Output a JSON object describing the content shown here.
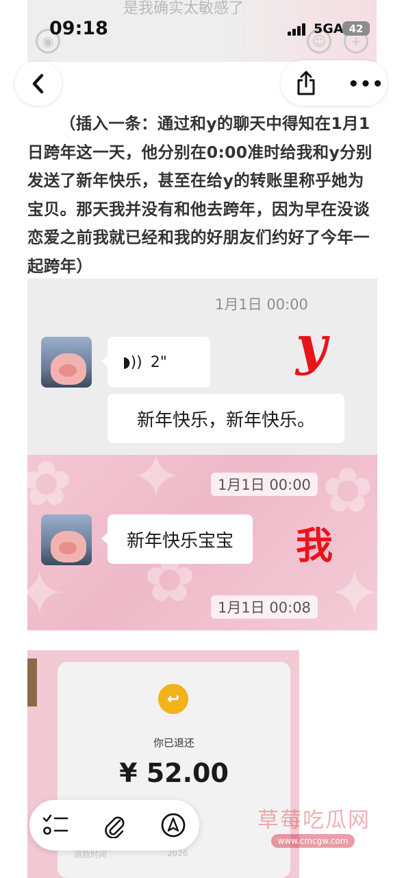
{
  "status_bar": {
    "time": "09:18",
    "network": "5GA",
    "battery": "42"
  },
  "background_strip": {
    "text": "是我确实太敏感了"
  },
  "nav": {
    "back_icon": "chevron-left-icon",
    "share_icon": "share-icon",
    "more_icon": "more-icon"
  },
  "article": {
    "paragraph": "（插入一条：通过和y的聊天中得知在1月1日跨年这一天，他分别在0:00准时给我和y分别发送了新年快乐，甚至在给y的转账里称乎她为宝贝。那天我并没有和他去跨年，因为早在没谈恋爱之前我就已经和我的好朋友们约好了今年一起跨年）"
  },
  "chat_y": {
    "timestamp": "1月1日 00:00",
    "voice_duration": "2\"",
    "message": "新年快乐，新年快乐。",
    "annotation": "y"
  },
  "chat_me": {
    "timestamp_top": "1月1日 00:00",
    "message": "新年快乐宝宝",
    "annotation": "我",
    "timestamp_bottom": "1月1日 00:08"
  },
  "transfer": {
    "status_label": "你已退还",
    "amount": "¥ 52.00",
    "row_label": "退款时间",
    "year_fragment": "2026"
  },
  "toolbar": {
    "items": [
      "list-icon",
      "paperclip-icon",
      "navigate-icon"
    ]
  },
  "watermark": {
    "title": "草莓吃瓜网",
    "url": "www.cmcgw.com"
  }
}
